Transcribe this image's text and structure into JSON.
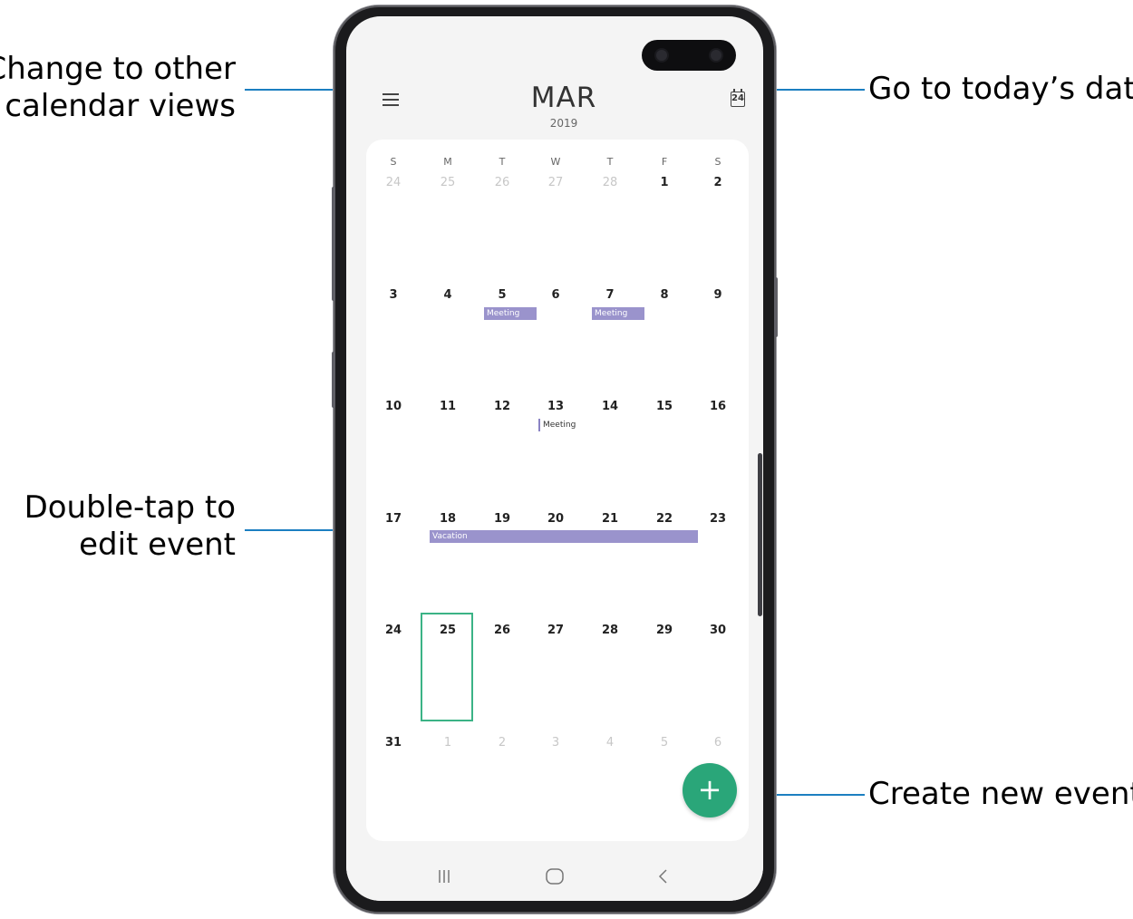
{
  "callouts": {
    "change_views": [
      "Change to other",
      "calendar views"
    ],
    "today": "Go to today’s date",
    "edit_event": [
      "Double-tap to",
      "edit event"
    ],
    "create_event": "Create new event"
  },
  "header": {
    "month": "MAR",
    "year": "2019",
    "today_icon_day": "24",
    "menu_icon": "hamburger-menu-icon",
    "today_icon": "calendar-today-icon"
  },
  "weekdays": [
    "S",
    "M",
    "T",
    "W",
    "T",
    "F",
    "S"
  ],
  "weeks": [
    [
      {
        "d": "24",
        "muted": true
      },
      {
        "d": "25",
        "muted": true
      },
      {
        "d": "26",
        "muted": true
      },
      {
        "d": "27",
        "muted": true
      },
      {
        "d": "28",
        "muted": true
      },
      {
        "d": "1"
      },
      {
        "d": "2"
      }
    ],
    [
      {
        "d": "3"
      },
      {
        "d": "4"
      },
      {
        "d": "5"
      },
      {
        "d": "6"
      },
      {
        "d": "7"
      },
      {
        "d": "8"
      },
      {
        "d": "9"
      }
    ],
    [
      {
        "d": "10"
      },
      {
        "d": "11"
      },
      {
        "d": "12"
      },
      {
        "d": "13"
      },
      {
        "d": "14"
      },
      {
        "d": "15"
      },
      {
        "d": "16"
      }
    ],
    [
      {
        "d": "17"
      },
      {
        "d": "18"
      },
      {
        "d": "19"
      },
      {
        "d": "20"
      },
      {
        "d": "21"
      },
      {
        "d": "22"
      },
      {
        "d": "23"
      }
    ],
    [
      {
        "d": "24"
      },
      {
        "d": "25"
      },
      {
        "d": "26"
      },
      {
        "d": "27"
      },
      {
        "d": "28"
      },
      {
        "d": "29"
      },
      {
        "d": "30"
      }
    ],
    [
      {
        "d": "31"
      },
      {
        "d": "1",
        "muted": true
      },
      {
        "d": "2",
        "muted": true
      },
      {
        "d": "3",
        "muted": true
      },
      {
        "d": "4",
        "muted": true
      },
      {
        "d": "5",
        "muted": true
      },
      {
        "d": "6",
        "muted": true
      }
    ]
  ],
  "events": {
    "meeting_5": "Meeting",
    "meeting_7": "Meeting",
    "meeting_13": "Meeting",
    "vacation": "Vacation"
  },
  "selected_day": "25",
  "fab": {
    "symbol": "+",
    "icon": "plus-icon"
  },
  "nav": {
    "recent_icon": "recent-apps-icon",
    "home_icon": "home-icon",
    "back_icon": "back-icon"
  },
  "colors": {
    "accent": "#2aa679",
    "event": "#9a93cc",
    "callout_line": "#1c7fc1",
    "selection": "#3bb386"
  }
}
